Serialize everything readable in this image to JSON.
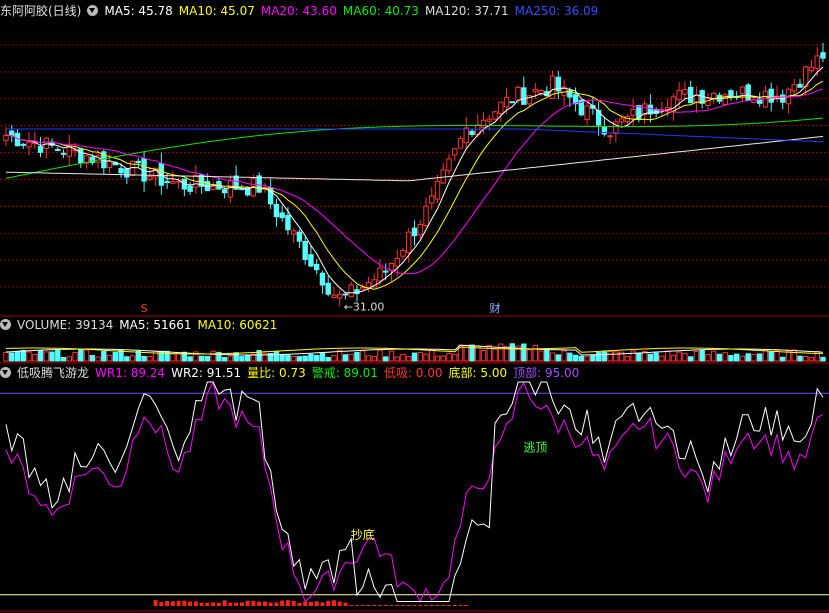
{
  "main_header": {
    "stock": "东阿阿胶(日线)",
    "ma5": "MA5: 45.78",
    "ma10": "MA10: 45.07",
    "ma20": "MA20: 43.60",
    "ma60": "MA60: 40.73",
    "ma120": "MA120: 37.71",
    "ma250": "MA250: 36.09"
  },
  "volume_header": {
    "volume": "VOLUME: 39134",
    "ma5": "MA5: 51661",
    "ma10": "MA10: 60621"
  },
  "indicator_header": {
    "name": "低吸腾飞游龙",
    "wr1": "WR1: 89.24",
    "wr2": "WR2: 91.51",
    "ratio": "量比: 0.73",
    "alert": "警戒: 89.01",
    "low": "低吸: 0.00",
    "bottom": "底部: 5.00",
    "top": "顶部: 95.00"
  },
  "annotations": {
    "low_price": "31.00",
    "marker_s": "S",
    "marker_cai": "财",
    "chaodi": "抄底",
    "taoding": "逃顶"
  },
  "colors": {
    "up": "#ff3232",
    "down": "#54fcfc",
    "ma5": "#ffffff",
    "ma10": "#ffff00",
    "ma20": "#ff00ff",
    "ma60": "#00e600",
    "ma120": "#e8e8e8",
    "ma250": "#1e3cff",
    "wr1": "#ff00ff",
    "wr2": "#ffffff",
    "grid": "#8b0000",
    "border": "#b00000"
  },
  "chart_data": [
    {
      "type": "candlestick",
      "title": "东阿阿胶(日线)",
      "price_range": [
        30,
        54
      ],
      "key_points": [
        {
          "x": 0,
          "close": 44.5
        },
        {
          "x": 15,
          "close": 42.7
        },
        {
          "x": 30,
          "close": 40.5
        },
        {
          "x": 44,
          "close": 40.3
        },
        {
          "x": 52,
          "close": 35.0
        },
        {
          "x": 58,
          "close": 31.0
        },
        {
          "x": 66,
          "close": 33.5
        },
        {
          "x": 74,
          "close": 39.0
        },
        {
          "x": 80,
          "close": 45.0
        },
        {
          "x": 88,
          "close": 47.5
        },
        {
          "x": 95,
          "close": 48.5
        },
        {
          "x": 105,
          "close": 45.0
        },
        {
          "x": 115,
          "close": 47.5
        },
        {
          "x": 125,
          "close": 48.0
        },
        {
          "x": 135,
          "close": 47.8
        },
        {
          "x": 142,
          "close": 51.0
        }
      ],
      "lowest_label": "31.00",
      "moving_averages": [
        "MA5",
        "MA10",
        "MA20",
        "MA60",
        "MA120",
        "MA250"
      ]
    },
    {
      "type": "bar",
      "title": "VOLUME",
      "current": 39134,
      "ma5": 51661,
      "ma10": 60621
    },
    {
      "type": "line",
      "title": "低吸腾飞游龙",
      "ylim": [
        0,
        100
      ],
      "series": [
        {
          "name": "WR1",
          "last": 89.24
        },
        {
          "name": "WR2",
          "last": 91.51
        }
      ],
      "reference_lines": [
        {
          "name": "底部",
          "value": 5.0
        },
        {
          "name": "顶部",
          "value": 95.0
        }
      ]
    }
  ]
}
